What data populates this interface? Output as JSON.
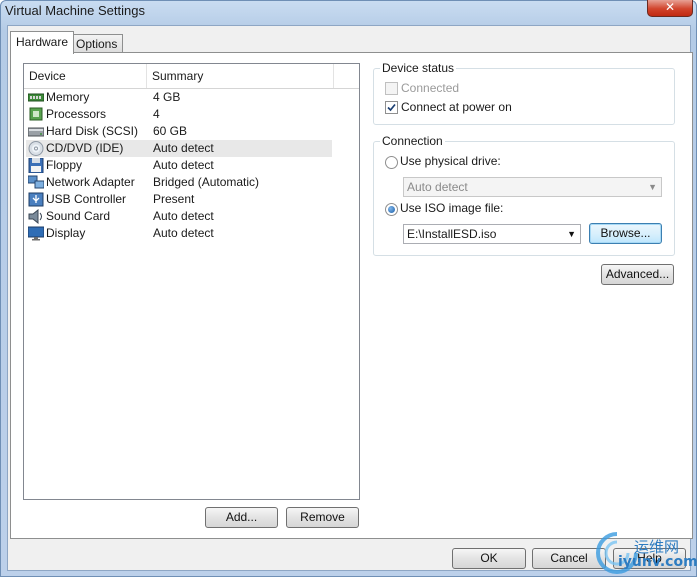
{
  "window": {
    "title": "Virtual Machine Settings",
    "close_label": "✕"
  },
  "tabs": [
    {
      "label": "Hardware",
      "active": true
    },
    {
      "label": "Options",
      "active": false
    }
  ],
  "device_list": {
    "columns": [
      "Device",
      "Summary"
    ],
    "rows": [
      {
        "name": "Memory",
        "summary": "4 GB",
        "icon": "memory-icon"
      },
      {
        "name": "Processors",
        "summary": "4",
        "icon": "processor-icon"
      },
      {
        "name": "Hard Disk (SCSI)",
        "summary": "60 GB",
        "icon": "hard-disk-icon"
      },
      {
        "name": "CD/DVD (IDE)",
        "summary": "Auto detect",
        "icon": "cd-dvd-icon",
        "selected": true
      },
      {
        "name": "Floppy",
        "summary": "Auto detect",
        "icon": "floppy-icon"
      },
      {
        "name": "Network Adapter",
        "summary": "Bridged (Automatic)",
        "icon": "network-adapter-icon"
      },
      {
        "name": "USB Controller",
        "summary": "Present",
        "icon": "usb-icon"
      },
      {
        "name": "Sound Card",
        "summary": "Auto detect",
        "icon": "sound-card-icon"
      },
      {
        "name": "Display",
        "summary": "Auto detect",
        "icon": "display-icon"
      }
    ],
    "add_label": "Add...",
    "remove_label": "Remove"
  },
  "device_status": {
    "title": "Device status",
    "connected_label": "Connected",
    "connected_checked": false,
    "connect_power_label": "Connect at power on",
    "connect_power_checked": true
  },
  "connection": {
    "title": "Connection",
    "physical_label": "Use physical drive:",
    "physical_value": "Auto detect",
    "iso_label": "Use ISO image file:",
    "iso_value": "E:\\InstallESD.iso",
    "browse_label": "Browse..."
  },
  "advanced_label": "Advanced...",
  "footer": {
    "ok_label": "OK",
    "cancel_label": "Cancel",
    "help_label": "Help"
  },
  "watermark": {
    "cn": "运维网",
    "en": "iyunv.com"
  },
  "colors": {
    "accent": "#1c5fa8",
    "selected_row": "#e8e8e8",
    "title_bar": "#bcd0ea"
  }
}
